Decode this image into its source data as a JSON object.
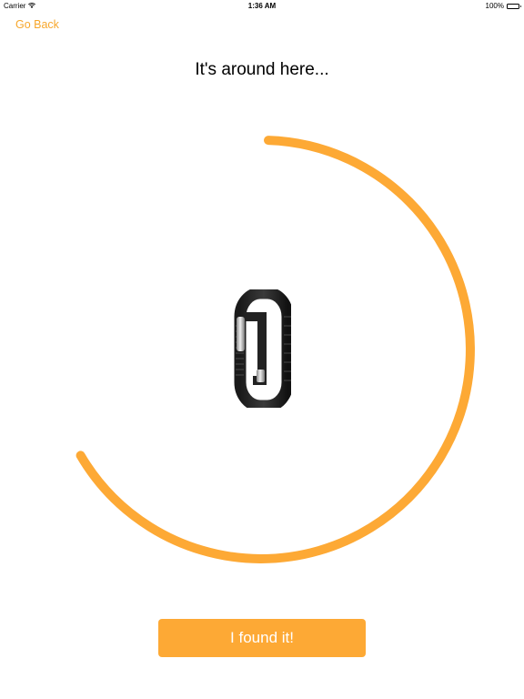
{
  "status_bar": {
    "carrier": "Carrier",
    "wifi_icon": "wifi-icon",
    "time": "1:36 AM",
    "battery": "100%",
    "battery_icon": "battery-full-icon"
  },
  "nav": {
    "back_label": "Go Back"
  },
  "main": {
    "title": "It's around here...",
    "device_image": "fitness-band-image",
    "search_progress": 0.66
  },
  "actions": {
    "found_label": "I found it!"
  },
  "colors": {
    "accent": "#f7a72b",
    "button": "#fda935",
    "ring": "#fda935",
    "background": "#ffffff"
  }
}
